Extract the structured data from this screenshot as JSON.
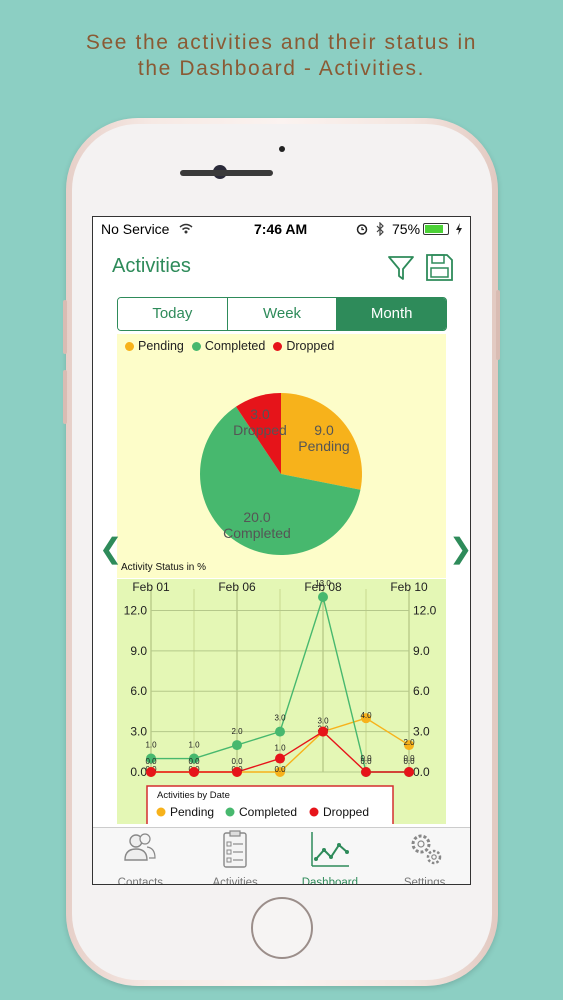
{
  "caption": {
    "line1": "See the activities and their status in",
    "line2": "the Dashboard - Activities."
  },
  "status_bar": {
    "carrier": "No Service",
    "time": "7:46 AM",
    "battery": "75%",
    "battery_level": 0.75
  },
  "nav": {
    "title": "Activities",
    "filter_icon": "filter-icon",
    "save_icon": "save-icon"
  },
  "segments": {
    "items": [
      "Today",
      "Week",
      "Month"
    ],
    "selected": "Month"
  },
  "pie": {
    "legend": [
      "Pending",
      "Completed",
      "Dropped"
    ],
    "labels": {
      "pending_value": "9.0",
      "pending_name": "Pending",
      "completed_value": "20.0",
      "completed_name": "Completed",
      "dropped_value": "3.0",
      "dropped_name": "Dropped"
    }
  },
  "line": {
    "title": "Activity Status in %",
    "x_ticks": [
      "Feb 01",
      "Feb 06",
      "Feb 08",
      "Feb 10"
    ],
    "y_ticks": [
      "0.0",
      "3.0",
      "6.0",
      "9.0",
      "12.0"
    ],
    "legend_title": "Activities by Date",
    "legend": [
      "Pending",
      "Completed",
      "Dropped"
    ]
  },
  "tabs": [
    {
      "label": "Contacts",
      "icon": "contacts-icon"
    },
    {
      "label": "Activities",
      "icon": "clipboard-icon"
    },
    {
      "label": "Dashboard",
      "icon": "line-chart-icon"
    },
    {
      "label": "Settings",
      "icon": "gears-icon"
    }
  ],
  "colors": {
    "accent": "#2e8b5a",
    "pending": "#f7b21b",
    "completed": "#47b86e",
    "dropped": "#e6141a",
    "background": "#8ccfc3"
  },
  "chart_data": [
    {
      "type": "pie",
      "categories": [
        "Pending",
        "Completed",
        "Dropped"
      ],
      "values": [
        9.0,
        20.0,
        3.0
      ],
      "legend": "top-left"
    },
    {
      "type": "line",
      "title": "Activity Status in %",
      "ylim": [
        0,
        13
      ],
      "grid": true,
      "legend": "bottom",
      "x": [
        0,
        1,
        2,
        3,
        4,
        5,
        6
      ],
      "series": [
        {
          "name": "Pending",
          "values": [
            0,
            0,
            0,
            0,
            3,
            4,
            2
          ]
        },
        {
          "name": "Completed",
          "values": [
            1,
            1,
            2,
            3,
            13,
            0,
            0
          ]
        },
        {
          "name": "Dropped",
          "values": [
            0,
            0,
            0,
            1,
            3,
            0,
            0
          ]
        }
      ]
    }
  ]
}
